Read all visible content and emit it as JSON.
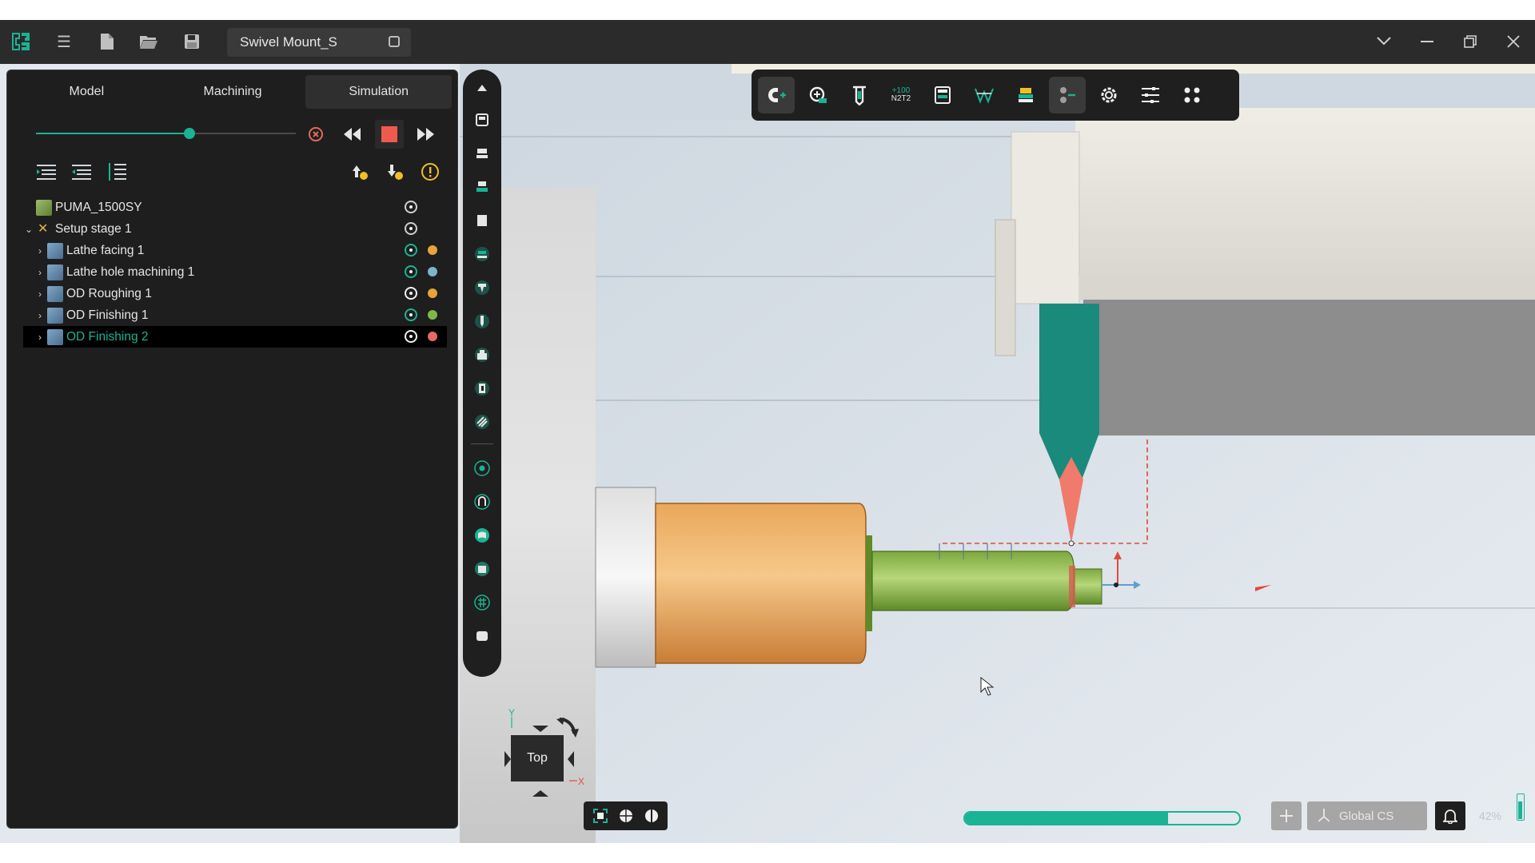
{
  "window": {
    "document_title": "Swivel Mount_S",
    "icons": [
      "app-logo-icon",
      "menu-icon",
      "new-file-icon",
      "open-folder-icon",
      "save-icon",
      "tab-icon",
      "chevron-down-icon",
      "minimize-icon",
      "restore-icon",
      "close-icon"
    ]
  },
  "panel": {
    "tabs": [
      {
        "label": "Model",
        "active": false
      },
      {
        "label": "Machining",
        "active": false
      },
      {
        "label": "Simulation",
        "active": true
      }
    ],
    "simulation": {
      "progress": 0.59
    },
    "tree": [
      {
        "label": "PUMA_1500SY",
        "level": 0,
        "icon": "machine-icon",
        "dot": null,
        "selected": false
      },
      {
        "label": "Setup stage 1",
        "level": 0,
        "icon": "setup-icon",
        "dot": null,
        "selected": false
      },
      {
        "label": "Lathe facing 1",
        "level": 1,
        "icon": "operation-icon",
        "dot": "#e8a33a",
        "eye": "green",
        "selected": false
      },
      {
        "label": "Lathe hole machining 1",
        "level": 1,
        "icon": "operation-icon",
        "dot": "#7fb3c8",
        "eye": "green",
        "selected": false
      },
      {
        "label": "OD Roughing 1",
        "level": 1,
        "icon": "operation-icon",
        "dot": "#e8a33a",
        "eye": "white",
        "selected": false
      },
      {
        "label": "OD Finishing 1",
        "level": 1,
        "icon": "operation-icon",
        "dot": "#7fb848",
        "eye": "green",
        "selected": false
      },
      {
        "label": "OD Finishing 2",
        "level": 1,
        "icon": "operation-icon",
        "dot": "#e86a5e",
        "eye": "white",
        "selected": true
      }
    ]
  },
  "toolbar": {
    "n2t2_top": "+100",
    "n2t2_bottom": "N2T2"
  },
  "viewcube": {
    "face_label": "Top",
    "axis_y": "Y",
    "axis_x": "X"
  },
  "statusbar": {
    "progress": 0.74,
    "coordinate_system": "Global CS",
    "zoom": "42%"
  },
  "colors": {
    "accent": "#1ab394",
    "panel_bg": "#1e1e1e",
    "titlebar_bg": "#2b2b2b"
  }
}
